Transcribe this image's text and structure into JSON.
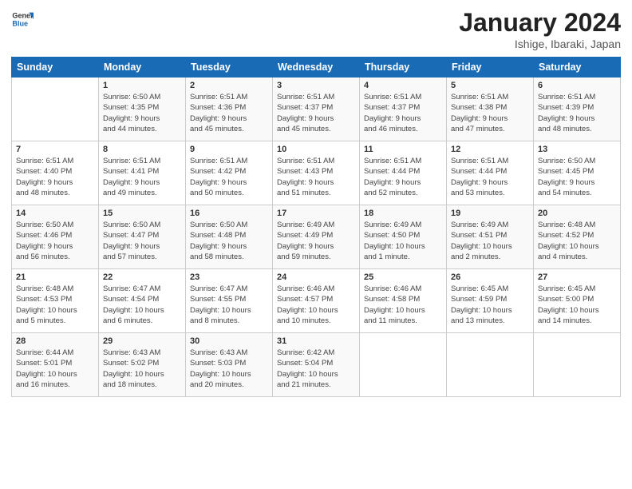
{
  "logo": {
    "line1": "General",
    "line2": "Blue"
  },
  "title": "January 2024",
  "subtitle": "Ishige, Ibaraki, Japan",
  "days_of_week": [
    "Sunday",
    "Monday",
    "Tuesday",
    "Wednesday",
    "Thursday",
    "Friday",
    "Saturday"
  ],
  "weeks": [
    [
      {
        "day": "",
        "content": ""
      },
      {
        "day": "1",
        "content": "Sunrise: 6:50 AM\nSunset: 4:35 PM\nDaylight: 9 hours\nand 44 minutes."
      },
      {
        "day": "2",
        "content": "Sunrise: 6:51 AM\nSunset: 4:36 PM\nDaylight: 9 hours\nand 45 minutes."
      },
      {
        "day": "3",
        "content": "Sunrise: 6:51 AM\nSunset: 4:37 PM\nDaylight: 9 hours\nand 45 minutes."
      },
      {
        "day": "4",
        "content": "Sunrise: 6:51 AM\nSunset: 4:37 PM\nDaylight: 9 hours\nand 46 minutes."
      },
      {
        "day": "5",
        "content": "Sunrise: 6:51 AM\nSunset: 4:38 PM\nDaylight: 9 hours\nand 47 minutes."
      },
      {
        "day": "6",
        "content": "Sunrise: 6:51 AM\nSunset: 4:39 PM\nDaylight: 9 hours\nand 48 minutes."
      }
    ],
    [
      {
        "day": "7",
        "content": "Sunrise: 6:51 AM\nSunset: 4:40 PM\nDaylight: 9 hours\nand 48 minutes."
      },
      {
        "day": "8",
        "content": "Sunrise: 6:51 AM\nSunset: 4:41 PM\nDaylight: 9 hours\nand 49 minutes."
      },
      {
        "day": "9",
        "content": "Sunrise: 6:51 AM\nSunset: 4:42 PM\nDaylight: 9 hours\nand 50 minutes."
      },
      {
        "day": "10",
        "content": "Sunrise: 6:51 AM\nSunset: 4:43 PM\nDaylight: 9 hours\nand 51 minutes."
      },
      {
        "day": "11",
        "content": "Sunrise: 6:51 AM\nSunset: 4:44 PM\nDaylight: 9 hours\nand 52 minutes."
      },
      {
        "day": "12",
        "content": "Sunrise: 6:51 AM\nSunset: 4:44 PM\nDaylight: 9 hours\nand 53 minutes."
      },
      {
        "day": "13",
        "content": "Sunrise: 6:50 AM\nSunset: 4:45 PM\nDaylight: 9 hours\nand 54 minutes."
      }
    ],
    [
      {
        "day": "14",
        "content": "Sunrise: 6:50 AM\nSunset: 4:46 PM\nDaylight: 9 hours\nand 56 minutes."
      },
      {
        "day": "15",
        "content": "Sunrise: 6:50 AM\nSunset: 4:47 PM\nDaylight: 9 hours\nand 57 minutes."
      },
      {
        "day": "16",
        "content": "Sunrise: 6:50 AM\nSunset: 4:48 PM\nDaylight: 9 hours\nand 58 minutes."
      },
      {
        "day": "17",
        "content": "Sunrise: 6:49 AM\nSunset: 4:49 PM\nDaylight: 9 hours\nand 59 minutes."
      },
      {
        "day": "18",
        "content": "Sunrise: 6:49 AM\nSunset: 4:50 PM\nDaylight: 10 hours\nand 1 minute."
      },
      {
        "day": "19",
        "content": "Sunrise: 6:49 AM\nSunset: 4:51 PM\nDaylight: 10 hours\nand 2 minutes."
      },
      {
        "day": "20",
        "content": "Sunrise: 6:48 AM\nSunset: 4:52 PM\nDaylight: 10 hours\nand 4 minutes."
      }
    ],
    [
      {
        "day": "21",
        "content": "Sunrise: 6:48 AM\nSunset: 4:53 PM\nDaylight: 10 hours\nand 5 minutes."
      },
      {
        "day": "22",
        "content": "Sunrise: 6:47 AM\nSunset: 4:54 PM\nDaylight: 10 hours\nand 6 minutes."
      },
      {
        "day": "23",
        "content": "Sunrise: 6:47 AM\nSunset: 4:55 PM\nDaylight: 10 hours\nand 8 minutes."
      },
      {
        "day": "24",
        "content": "Sunrise: 6:46 AM\nSunset: 4:57 PM\nDaylight: 10 hours\nand 10 minutes."
      },
      {
        "day": "25",
        "content": "Sunrise: 6:46 AM\nSunset: 4:58 PM\nDaylight: 10 hours\nand 11 minutes."
      },
      {
        "day": "26",
        "content": "Sunrise: 6:45 AM\nSunset: 4:59 PM\nDaylight: 10 hours\nand 13 minutes."
      },
      {
        "day": "27",
        "content": "Sunrise: 6:45 AM\nSunset: 5:00 PM\nDaylight: 10 hours\nand 14 minutes."
      }
    ],
    [
      {
        "day": "28",
        "content": "Sunrise: 6:44 AM\nSunset: 5:01 PM\nDaylight: 10 hours\nand 16 minutes."
      },
      {
        "day": "29",
        "content": "Sunrise: 6:43 AM\nSunset: 5:02 PM\nDaylight: 10 hours\nand 18 minutes."
      },
      {
        "day": "30",
        "content": "Sunrise: 6:43 AM\nSunset: 5:03 PM\nDaylight: 10 hours\nand 20 minutes."
      },
      {
        "day": "31",
        "content": "Sunrise: 6:42 AM\nSunset: 5:04 PM\nDaylight: 10 hours\nand 21 minutes."
      },
      {
        "day": "",
        "content": ""
      },
      {
        "day": "",
        "content": ""
      },
      {
        "day": "",
        "content": ""
      }
    ]
  ]
}
